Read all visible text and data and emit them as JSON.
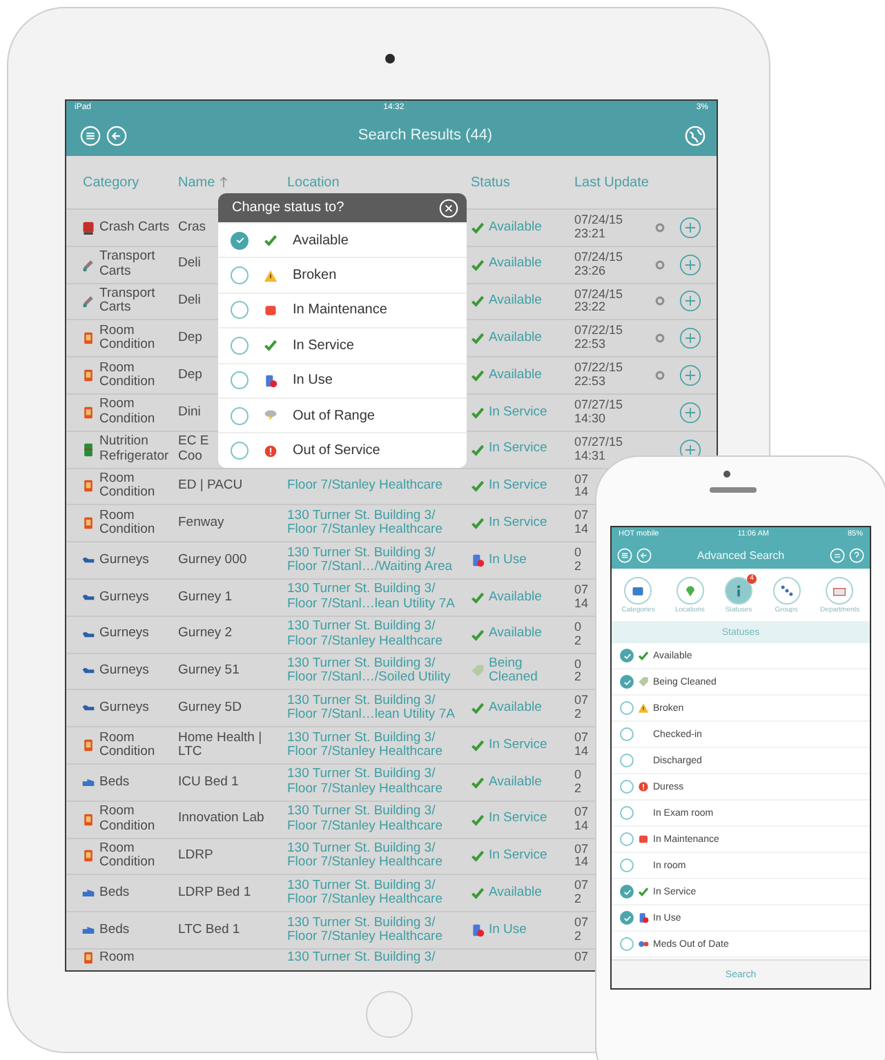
{
  "tablet": {
    "status_bar": {
      "carrier": "iPad",
      "time": "14:32",
      "battery": "3%"
    },
    "title": "Search Results (44)",
    "columns": [
      "Category",
      "Name",
      "Location",
      "Status",
      "Last Update"
    ],
    "rows": [
      {
        "kind": "crash_cart",
        "category": "Crash Carts",
        "name": "Cras",
        "status": {
          "kind": "check",
          "label": "Available"
        },
        "date": "07/24/15\n23:21",
        "gear": true,
        "add": true
      },
      {
        "kind": "transport",
        "category": "Transport Carts",
        "name": "Deli",
        "status": {
          "kind": "check",
          "label": "Available"
        },
        "date": "07/24/15\n23:26",
        "gear": true,
        "add": true
      },
      {
        "kind": "transport",
        "category": "Transport Carts",
        "name": "Deli",
        "status": {
          "kind": "check",
          "label": "Available"
        },
        "date": "07/24/15\n23:22",
        "gear": true,
        "add": true
      },
      {
        "kind": "room",
        "category": "Room Condition",
        "name": "Dep",
        "status": {
          "kind": "check",
          "label": "Available"
        },
        "date": "07/22/15\n22:53",
        "gear": true,
        "add": true
      },
      {
        "kind": "room",
        "category": "Room Condition",
        "name": "Dep",
        "status": {
          "kind": "check",
          "label": "Available"
        },
        "date": "07/22/15\n22:53",
        "gear": true,
        "add": true
      },
      {
        "kind": "room",
        "category": "Room Condition",
        "name": "Dini",
        "status": {
          "kind": "check",
          "label": "In Service"
        },
        "date": "07/27/15\n14:30",
        "gear": false,
        "add": true
      },
      {
        "kind": "fridge",
        "category": "Nutrition Refrigerator",
        "name": "EC E\nCoo",
        "status": {
          "kind": "check",
          "label": "In Service"
        },
        "date": "07/27/15\n14:31",
        "gear": false,
        "add": true
      },
      {
        "kind": "room",
        "category": "Room Condition",
        "name": "ED | PACU",
        "location": "Floor 7/Stanley Healthcare",
        "status": {
          "kind": "check",
          "label": "In Service"
        },
        "date": "07\n14"
      },
      {
        "kind": "room",
        "category": "Room Condition",
        "name": "Fenway",
        "location": "130 Turner St. Building 3/\nFloor 7/Stanley Healthcare",
        "status": {
          "kind": "check",
          "label": "In Service"
        },
        "date": "07\n14"
      },
      {
        "kind": "gurney",
        "category": "Gurneys",
        "name": "Gurney 000",
        "location": "130 Turner St. Building 3/\nFloor 7/Stanl…/Waiting Area",
        "status": {
          "kind": "in_use",
          "label": "In Use"
        },
        "date": "0\n2"
      },
      {
        "kind": "gurney",
        "category": "Gurneys",
        "name": "Gurney 1",
        "location": "130 Turner St. Building 3/\nFloor 7/Stanl…lean Utility 7A",
        "status": {
          "kind": "check",
          "label": "Available"
        },
        "date": "07\n14"
      },
      {
        "kind": "gurney",
        "category": "Gurneys",
        "name": "Gurney 2",
        "location": "130 Turner St. Building 3/\nFloor 7/Stanley Healthcare",
        "status": {
          "kind": "check",
          "label": "Available"
        },
        "date": "0\n2"
      },
      {
        "kind": "gurney",
        "category": "Gurneys",
        "name": "Gurney 51",
        "location": "130 Turner St. Building 3/\nFloor 7/Stanl…/Soiled Utility",
        "status": {
          "kind": "tag",
          "label": "Being\nCleaned"
        },
        "date": "0\n2"
      },
      {
        "kind": "gurney",
        "category": "Gurneys",
        "name": "Gurney 5D",
        "location": "130 Turner St. Building 3/\nFloor 7/Stanl…lean Utility 7A",
        "status": {
          "kind": "check",
          "label": "Available"
        },
        "date": "07\n2"
      },
      {
        "kind": "room",
        "category": "Room Condition",
        "name": "Home Health | LTC",
        "location": "130 Turner St. Building 3/\nFloor 7/Stanley Healthcare",
        "status": {
          "kind": "check",
          "label": "In Service"
        },
        "date": "07\n14"
      },
      {
        "kind": "bed",
        "category": "Beds",
        "name": "ICU Bed 1",
        "location": "130 Turner St. Building 3/\nFloor 7/Stanley Healthcare",
        "status": {
          "kind": "check",
          "label": "Available"
        },
        "date": "0\n2"
      },
      {
        "kind": "room",
        "category": "Room Condition",
        "name": "Innovation Lab",
        "location": "130 Turner St. Building 3/\nFloor 7/Stanley Healthcare",
        "status": {
          "kind": "check",
          "label": "In Service"
        },
        "date": "07\n14"
      },
      {
        "kind": "room",
        "category": "Room Condition",
        "name": "LDRP",
        "location": "130 Turner St. Building 3/\nFloor 7/Stanley Healthcare",
        "status": {
          "kind": "check",
          "label": "In Service"
        },
        "date": "07\n14"
      },
      {
        "kind": "bed",
        "category": "Beds",
        "name": "LDRP Bed 1",
        "location": "130 Turner St. Building 3/\nFloor 7/Stanley Healthcare",
        "status": {
          "kind": "check",
          "label": "Available"
        },
        "date": "07\n2"
      },
      {
        "kind": "bed",
        "category": "Beds",
        "name": "LTC Bed 1",
        "location": "130 Turner St. Building 3/\nFloor 7/Stanley Healthcare",
        "status": {
          "kind": "in_use",
          "label": "In Use"
        },
        "date": "07\n2"
      },
      {
        "kind": "room",
        "category": "Room",
        "location": "130 Turner St. Building 3/",
        "date": "07"
      }
    ],
    "popup": {
      "title": "Change status to?",
      "options": [
        {
          "kind": "check",
          "label": "Available",
          "selected": true
        },
        {
          "kind": "warning",
          "label": "Broken",
          "selected": false
        },
        {
          "kind": "square",
          "label": "In Maintenance",
          "selected": false
        },
        {
          "kind": "check",
          "label": "In Service",
          "selected": false
        },
        {
          "kind": "in_use",
          "label": "In Use",
          "selected": false
        },
        {
          "kind": "cloud",
          "label": "Out of Range",
          "selected": false
        },
        {
          "kind": "alert",
          "label": "Out of Service",
          "selected": false
        }
      ]
    }
  },
  "phone": {
    "status_bar": {
      "carrier": "HOT mobile",
      "time": "11:06 AM",
      "battery": "85%"
    },
    "title": "Advanced Search",
    "tabs": [
      {
        "kind": "tray",
        "label": "Categories",
        "selected": false
      },
      {
        "kind": "pin",
        "label": "Locations",
        "selected": false
      },
      {
        "kind": "info",
        "label": "Statuses",
        "selected": true,
        "badge": "4"
      },
      {
        "kind": "network",
        "label": "Groups",
        "selected": false
      },
      {
        "kind": "building",
        "label": "Departments",
        "selected": false
      }
    ],
    "section": "Statuses",
    "statuses": [
      {
        "kind": "check",
        "label": "Available",
        "checked": true
      },
      {
        "kind": "tag",
        "label": "Being Cleaned",
        "checked": true
      },
      {
        "kind": "warning",
        "label": "Broken",
        "checked": false
      },
      {
        "kind": "none",
        "label": "Checked-in",
        "checked": false
      },
      {
        "kind": "none",
        "label": "Discharged",
        "checked": false
      },
      {
        "kind": "alert",
        "label": "Duress",
        "checked": false
      },
      {
        "kind": "none",
        "label": "In Exam room",
        "checked": false
      },
      {
        "kind": "square",
        "label": "In Maintenance",
        "checked": false
      },
      {
        "kind": "none",
        "label": "In room",
        "checked": false
      },
      {
        "kind": "check",
        "label": "In Service",
        "checked": true
      },
      {
        "kind": "in_use",
        "label": "In Use",
        "checked": true
      },
      {
        "kind": "pill",
        "label": "Meds Out of Date",
        "checked": false
      }
    ],
    "button": "Search"
  }
}
